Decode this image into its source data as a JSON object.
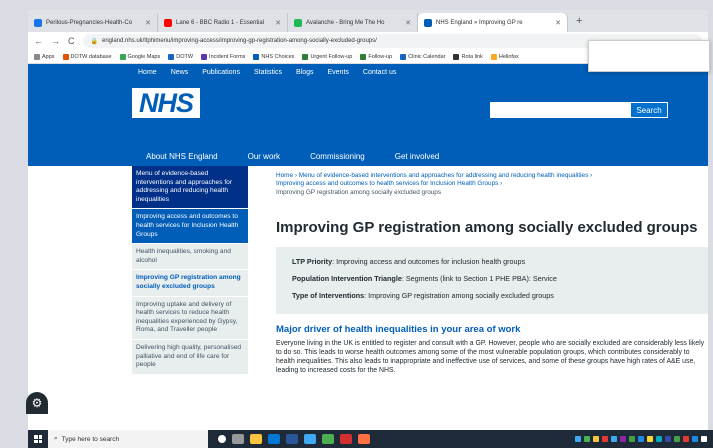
{
  "browser": {
    "tabs": [
      {
        "label": "Perilous-Pregnancies-Health-Co",
        "color": "#1a73e8",
        "active": false
      },
      {
        "label": "Lane 6 - BBC Radio 1 - Essential",
        "color": "#ff0000",
        "active": false
      },
      {
        "label": "Avalanche - Bring Me The Ho",
        "color": "#1db954",
        "active": false
      },
      {
        "label": "NHS England » Improving GP re",
        "color": "#005eb8",
        "active": true
      }
    ],
    "url": "england.nhs.uk/ltphimenu/improving-access/improving-gp-registration-among-socially-excluded-groups/",
    "bookmarks": [
      {
        "label": "Apps",
        "color": "#888"
      },
      {
        "label": "DOTW database",
        "color": "#e65100"
      },
      {
        "label": "Google Maps",
        "color": "#34a853"
      },
      {
        "label": "DOTW",
        "color": "#1565c0"
      },
      {
        "label": "Incident Forms",
        "color": "#5e35b1"
      },
      {
        "label": "NHS Choices",
        "color": "#005eb8"
      },
      {
        "label": "Urgent Follow-up",
        "color": "#2e7d32"
      },
      {
        "label": "Follow-up",
        "color": "#2e7d32"
      },
      {
        "label": "Clinic Calendar",
        "color": "#1565c0"
      },
      {
        "label": "Rota link",
        "color": "#333"
      },
      {
        "label": "Hellofax",
        "color": "#f9a825"
      }
    ]
  },
  "nhs": {
    "topnav": [
      "Home",
      "News",
      "Publications",
      "Statistics",
      "Blogs",
      "Events",
      "Contact us"
    ],
    "logo": "NHS",
    "search_button": "Search",
    "mainnav": [
      "About NHS England",
      "Our work",
      "Commissioning",
      "Get involved"
    ],
    "sidebar": [
      {
        "label": "Menu of evidence-based interventions and approaches for addressing and reducing health inequalities",
        "style": "dark"
      },
      {
        "label": "Improving access and outcomes to health services for Inclusion Health Groups",
        "style": "blue"
      },
      {
        "label": "Health inequalities, smoking and alcohol",
        "style": "grey"
      },
      {
        "label": "Improving GP registration among socially excluded groups",
        "style": "active"
      },
      {
        "label": "Improving uptake and delivery of health services to reduce health inequalities experienced by Gypsy, Roma, and Traveller people",
        "style": "grey"
      },
      {
        "label": "Delivering high quality, personalised palliative and end of life care for people",
        "style": "grey"
      }
    ],
    "breadcrumb": {
      "home": "Home",
      "level1": "Menu of evidence-based interventions and approaches for addressing and reducing health inequalities",
      "level2": "Improving access and outcomes to health services for Inclusion Health Groups",
      "current": "Improving GP registration among socially excluded groups"
    },
    "title": "Improving GP registration among socially excluded groups",
    "info": {
      "ltp_label": "LTP Priority",
      "ltp_value": ": Improving access and outcomes for inclusion health groups",
      "pit_label": "Population Intervention Triangle",
      "pit_value": ": Segments (link to Section 1 PHE PBA): Service",
      "toi_label": "Type of Interventions",
      "toi_value": ": Improving GP registration among socially excluded groups"
    },
    "section_heading": "Major driver of health inequalities in your area of work",
    "section_text": "Everyone living in the UK is entitled to register and consult with a GP. However, people who are socially excluded are considerably less likely to do so. This leads to worse health outcomes among some of the most vulnerable population groups, which contributes considerably to health inequalities. This also leads to inappropriate and ineffective use of services, and some of these groups have high rates of A&E use, leading to increased costs for the NHS."
  },
  "taskbar": {
    "search_placeholder": "Type here to search"
  }
}
